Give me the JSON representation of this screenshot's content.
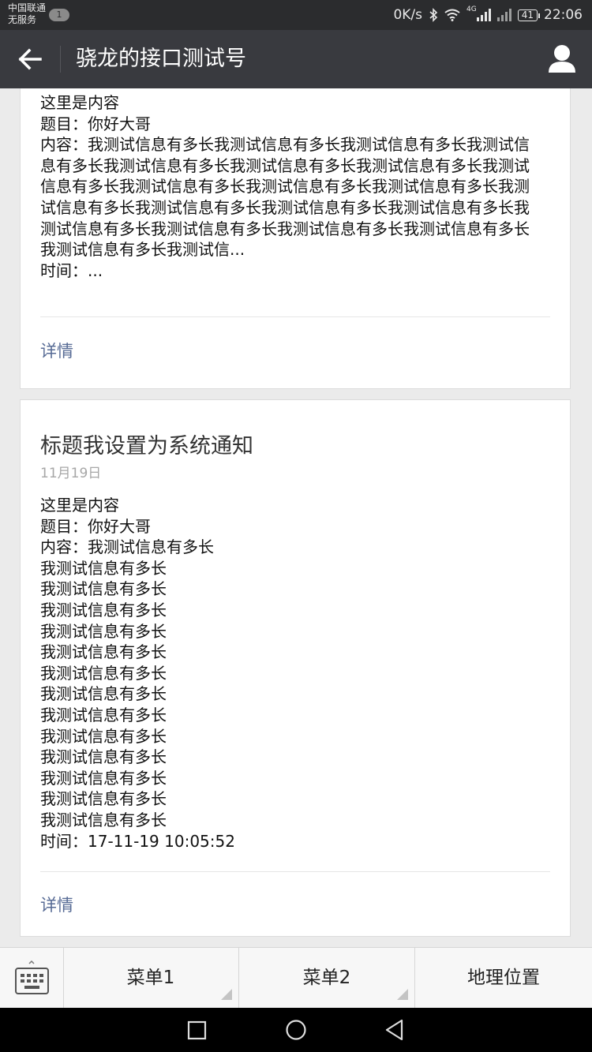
{
  "status_bar": {
    "carrier_line1": "中国联通",
    "carrier_line2": "无服务",
    "notification_count": "1",
    "net_speed": "0K/s",
    "network_type": "4G",
    "battery": "41",
    "time": "22:06"
  },
  "nav": {
    "title": "骁龙的接口测试号",
    "back_icon": "arrow-left-icon",
    "profile_icon": "person-icon"
  },
  "cards": [
    {
      "lines": [
        "这里是内容",
        "题目：你好大哥"
      ],
      "content_paragraph": "内容：我测试信息有多长我测试信息有多长我测试信息有多长我测试信息有多长我测试信息有多长我测试信息有多长我测试信息有多长我测试信息有多长我测试信息有多长我测试信息有多长我测试信息有多长我测试信息有多长我测试信息有多长我测试信息有多长我测试信息有多长我测试信息有多长我测试信息有多长我测试信息有多长我测试信息有多长我测试信息有多长我测试信...",
      "time_line": "时间：...",
      "detail_label": "详情"
    },
    {
      "title": "标题我设置为系统通知",
      "date": "11月19日",
      "lines": [
        "这里是内容",
        "题目：你好大哥",
        "内容：我测试信息有多长",
        "我测试信息有多长",
        "我测试信息有多长",
        "我测试信息有多长",
        "我测试信息有多长",
        "我测试信息有多长",
        "我测试信息有多长",
        "我测试信息有多长",
        "我测试信息有多长",
        "我测试信息有多长",
        "我测试信息有多长",
        "我测试信息有多长",
        "我测试信息有多长",
        "我测试信息有多长",
        "时间：17-11-19 10:05:52"
      ],
      "detail_label": "详情"
    }
  ],
  "menu": {
    "keyboard_icon": "keyboard-icon",
    "items": [
      "菜单1",
      "菜单2",
      "地理位置"
    ]
  },
  "colors": {
    "nav_bg": "#393a3f",
    "status_bg": "#2b2c2e",
    "link": "#576b95",
    "page_bg": "#ebebeb"
  }
}
